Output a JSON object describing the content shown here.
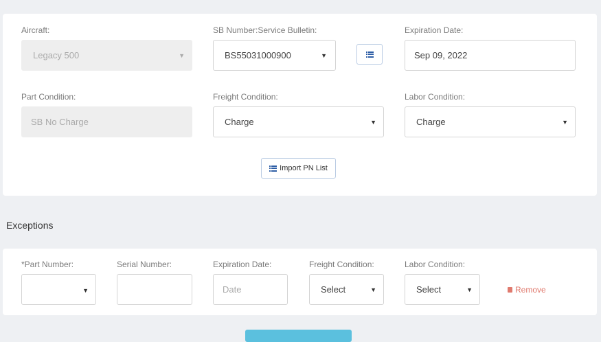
{
  "top": {
    "aircraft": {
      "label": "Aircraft:",
      "value": "Legacy 500"
    },
    "sb_number": {
      "label": "SB Number:Service Bulletin:",
      "value": "BS55031000900"
    },
    "expiration": {
      "label": "Expiration Date:",
      "value": "Sep 09, 2022"
    },
    "part_condition": {
      "label": "Part Condition:",
      "value": "SB No Charge"
    },
    "freight_condition": {
      "label": "Freight Condition:",
      "value": "Charge"
    },
    "labor_condition": {
      "label": "Labor Condition:",
      "value": "Charge"
    },
    "import_button": "Import PN List"
  },
  "exceptions": {
    "title": "Exceptions",
    "part_number_label": "*Part Number:",
    "serial_number_label": "Serial Number:",
    "expiration_label": "Expiration Date:",
    "expiration_placeholder": "Date",
    "freight_label": "Freight Condition:",
    "freight_value": "Select",
    "labor_label": "Labor Condition:",
    "labor_value": "Select",
    "remove_label": "Remove"
  },
  "colors": {
    "accent": "#2e5ea6",
    "primary_button": "#5bc0de",
    "remove": "#e07a6e"
  }
}
